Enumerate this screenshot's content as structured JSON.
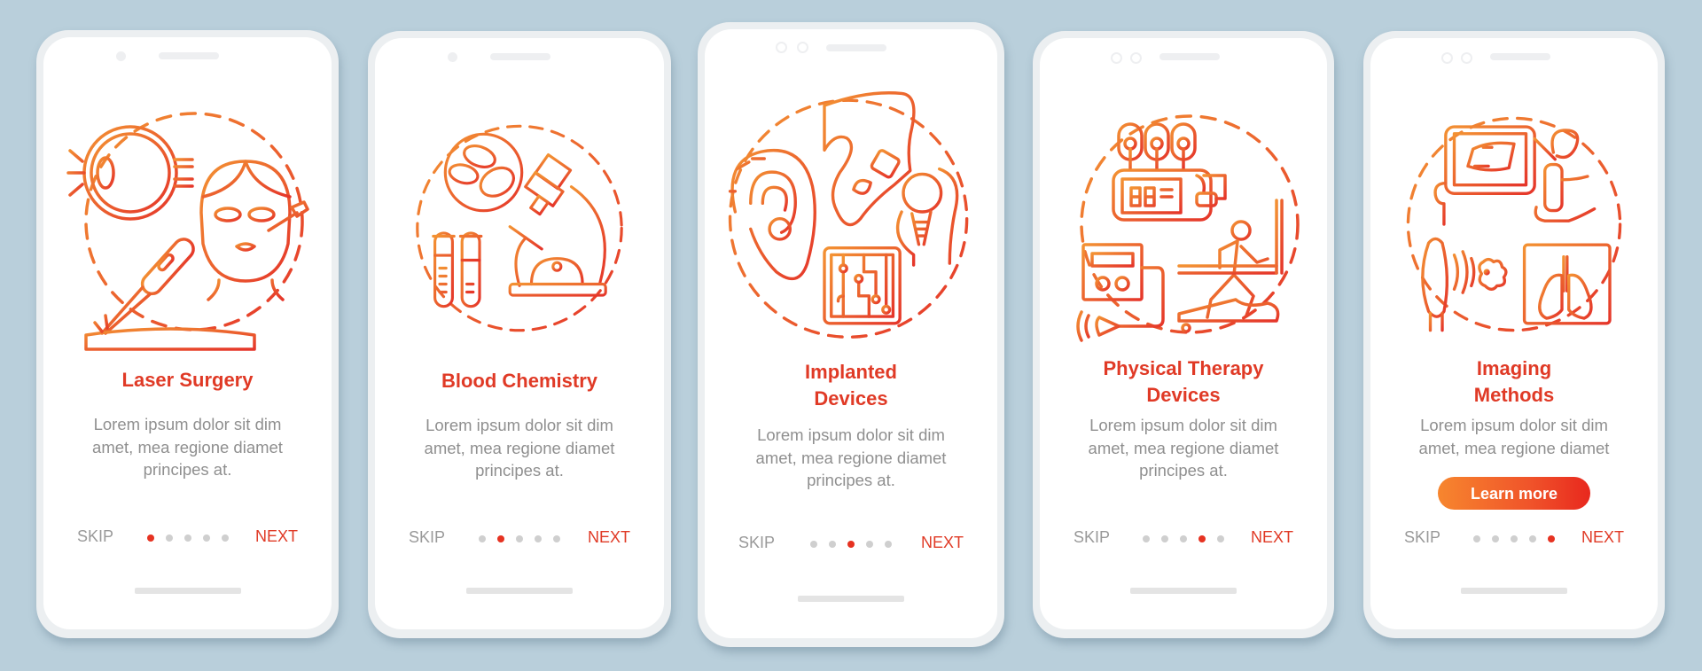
{
  "colors": {
    "background": "#b9cfdb",
    "accent": "#e03a26",
    "gradient_start": "#f39233",
    "gradient_end": "#e5352a",
    "active_dot": "#e63221",
    "inactive_dot": "#cfcfcf",
    "body_text": "#8f8f8f"
  },
  "screens": [
    {
      "title": "Laser Surgery",
      "title_lines": [
        "Laser Surgery"
      ],
      "body_lines": [
        "Lorem ipsum dolor sit dim",
        "amet, mea regione diamet",
        "principes at."
      ],
      "illustration": "laser-surgery-illustration",
      "skip_label": "SKIP",
      "next_label": "NEXT",
      "page_count": 5,
      "active_page": 1
    },
    {
      "title": "Blood Chemistry",
      "title_lines": [
        "Blood Chemistry"
      ],
      "body_lines": [
        "Lorem ipsum dolor sit dim",
        "amet, mea regione diamet",
        "principes at."
      ],
      "illustration": "blood-chemistry-illustration",
      "skip_label": "SKIP",
      "next_label": "NEXT",
      "page_count": 5,
      "active_page": 2
    },
    {
      "title": "Implanted Devices",
      "title_lines": [
        "Implanted",
        "Devices"
      ],
      "body_lines": [
        "Lorem ipsum dolor sit dim",
        "amet, mea regione diamet",
        "principes at."
      ],
      "illustration": "implanted-devices-illustration",
      "skip_label": "SKIP",
      "next_label": "NEXT",
      "page_count": 5,
      "active_page": 3
    },
    {
      "title": "Physical Therapy Devices",
      "title_lines": [
        "Physical Therapy",
        "Devices"
      ],
      "body_lines": [
        "Lorem ipsum dolor sit dim",
        "amet, mea regione diamet",
        "principes at."
      ],
      "illustration": "physical-therapy-illustration",
      "skip_label": "SKIP",
      "next_label": "NEXT",
      "page_count": 5,
      "active_page": 4
    },
    {
      "title": "Imaging Methods",
      "title_lines": [
        "Imaging",
        "Methods"
      ],
      "body_lines": [
        "Lorem ipsum dolor sit dim",
        "amet, mea regione diamet"
      ],
      "illustration": "imaging-methods-illustration",
      "cta_label": "Learn more",
      "skip_label": "SKIP",
      "next_label": "NEXT",
      "page_count": 5,
      "active_page": 5
    }
  ]
}
